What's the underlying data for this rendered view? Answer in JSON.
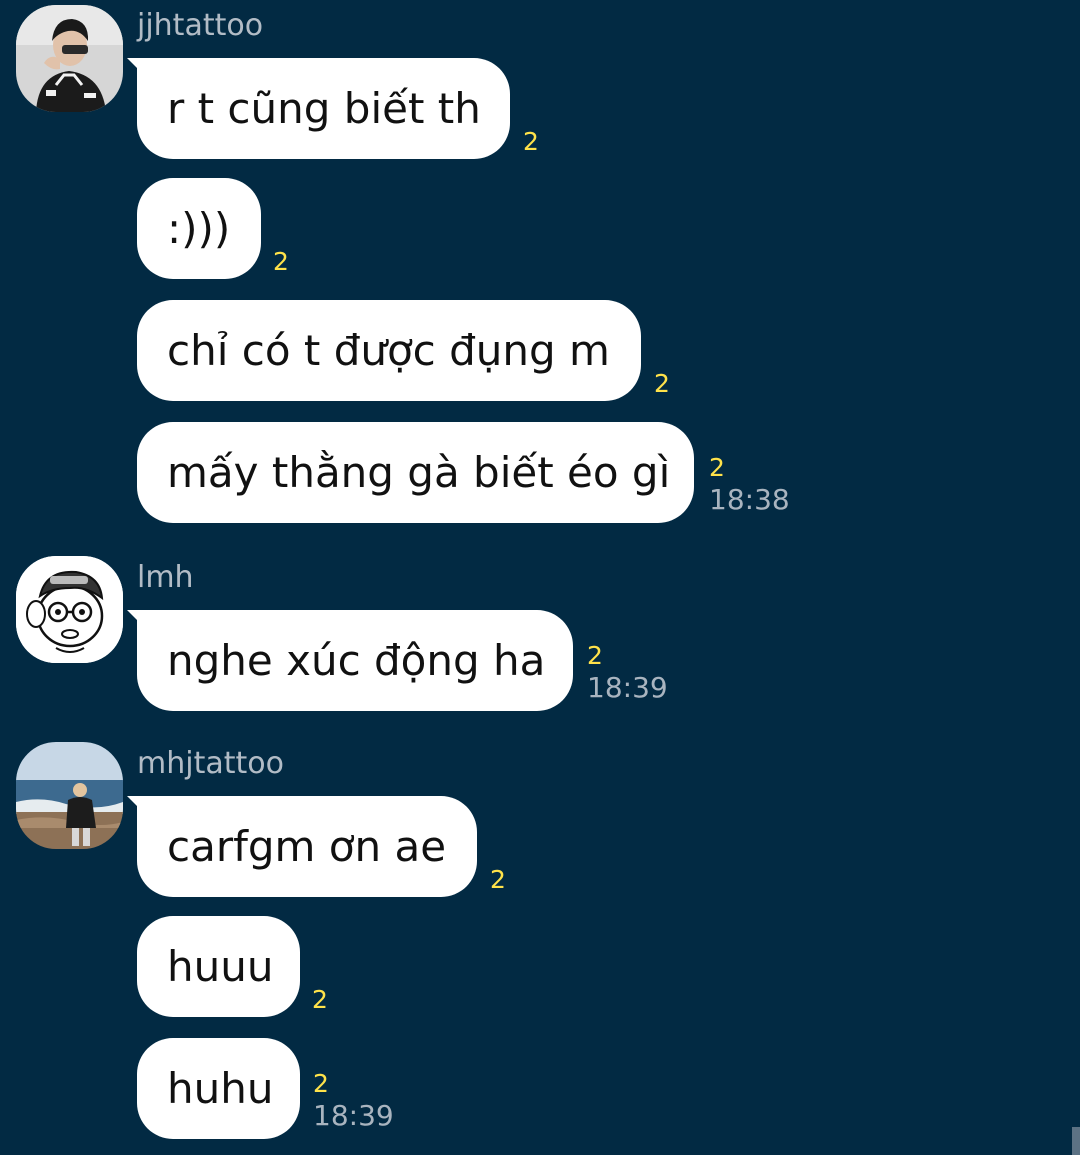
{
  "groups": [
    {
      "sender": "jjhtattoo",
      "avatar_icon": "user-photo-avatar-icon",
      "messages": [
        {
          "text": "r t cũng biết th",
          "count": "2"
        },
        {
          "text": ":)))",
          "count": "2"
        },
        {
          "text": "chỉ có t được đụng m",
          "count": "2"
        },
        {
          "text": "mấy thằng gà biết éo gì",
          "count": "2",
          "time": "18:38"
        }
      ]
    },
    {
      "sender": "lmh",
      "avatar_icon": "cartoon-face-avatar-icon",
      "messages": [
        {
          "text": "nghe xúc động ha",
          "count": "2",
          "time": "18:39"
        }
      ]
    },
    {
      "sender": "mhjtattoo",
      "avatar_icon": "beach-photo-avatar-icon",
      "messages": [
        {
          "text": "carfgm ơn ae",
          "count": "2"
        },
        {
          "text": "huuu",
          "count": "2"
        },
        {
          "text": "huhu",
          "count": "2",
          "time": "18:39"
        }
      ]
    }
  ],
  "colors": {
    "background": "#022a43",
    "bubble": "#ffffff",
    "unread_count": "#ffe24a",
    "timestamp": "#a9b4bf",
    "sender_name": "#b2bcc6"
  }
}
